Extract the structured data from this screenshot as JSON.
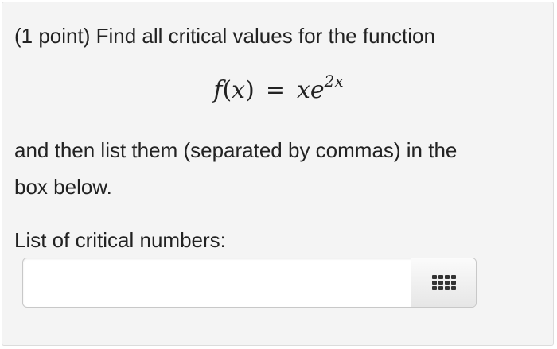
{
  "problem": {
    "intro": "(1 point) Find all critical values for the function",
    "equation": {
      "lhs_func": "f",
      "lhs_open": "(",
      "lhs_var": "x",
      "lhs_close": ")",
      "equals": "=",
      "rhs_var": "x",
      "rhs_base": "e",
      "rhs_exp": "2x"
    },
    "instruction_line1": "and then list them (separated by commas) in the",
    "instruction_line2": "box below.",
    "answer_label": "List of critical numbers:"
  },
  "answer": {
    "value": "",
    "placeholder": ""
  },
  "keypad_button": {
    "icon": "keypad-grid-icon"
  },
  "colors": {
    "panel_background": "#f4f4f4",
    "text": "#222222",
    "border": "#c8c8c8"
  }
}
